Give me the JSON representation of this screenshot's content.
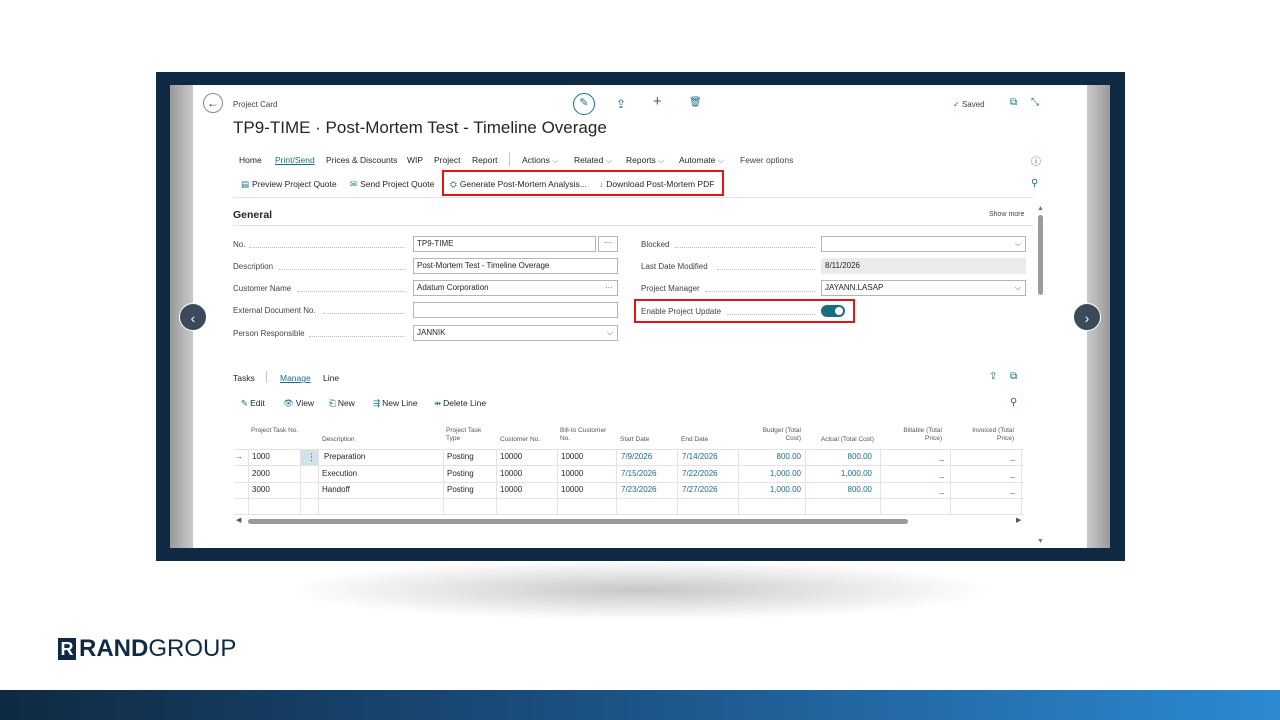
{
  "breadcrumb": "Project Card",
  "title": "TP9-TIME · Post-Mortem Test - Timeline Overage",
  "status": "Saved",
  "icons": {
    "back": "←",
    "edit": "✎",
    "share": "⇪",
    "add": "+",
    "delete": "🗑",
    "saved_check": "✓",
    "open_new": "⧉",
    "collapse": "⤡",
    "info": "ⓘ",
    "pin": "⚲",
    "prev": "‹",
    "next": "›"
  },
  "menu": [
    {
      "label": "Home",
      "active": false
    },
    {
      "label": "Print/Send",
      "active": true
    },
    {
      "label": "Prices & Discounts",
      "active": false
    },
    {
      "label": "WIP",
      "active": false
    },
    {
      "label": "Project",
      "active": false
    },
    {
      "label": "Report",
      "active": false
    },
    {
      "label": "Actions",
      "active": false
    },
    {
      "label": "Related",
      "active": false
    },
    {
      "label": "Reports",
      "active": false
    },
    {
      "label": "Automate",
      "active": false
    },
    {
      "label": "Fewer options",
      "active": false
    }
  ],
  "actions": {
    "preview": "Preview Project Quote",
    "send": "Send Project Quote",
    "generate": "Generate Post-Mortem Analysis...",
    "download": "Download Post-Mortem PDF"
  },
  "general": {
    "title": "General",
    "show_more": "Show more",
    "no_label": "No.",
    "no_value": "TP9-TIME",
    "description_label": "Description",
    "description_value": "Post-Mortem Test - Timeline Overage",
    "customer_label": "Customer Name",
    "customer_value": "Adatum Corporation",
    "ext_doc_label": "External Document No.",
    "ext_doc_value": "",
    "person_label": "Person Responsible",
    "person_value": "JANNIK",
    "blocked_label": "Blocked",
    "blocked_value": "",
    "last_modified_label": "Last Date Modified",
    "last_modified_value": "8/11/2026",
    "manager_label": "Project Manager",
    "manager_value": "JAYANN.LASAP",
    "enable_update_label": "Enable Project Update",
    "enable_update_on": true
  },
  "tasks": {
    "title": "Tasks",
    "tabs": [
      "Manage",
      "Line"
    ],
    "actions": [
      "Edit",
      "View",
      "New",
      "New Line",
      "Delete Line"
    ],
    "headers": [
      "Project Task No.",
      "Description",
      "Project Task Type",
      "Customer No.",
      "Bill-to Customer No.",
      "Start Date",
      "End Date",
      "Budget (Total Cost)",
      "Actual (Total Cost)",
      "Billable (Total Price)",
      "Invoiced (Total Price)"
    ],
    "rows": [
      {
        "no": "1000",
        "description": "Preparation",
        "type": "Posting",
        "customer": "10000",
        "bill_to": "10000",
        "start": "7/9/2026",
        "end": "7/14/2026",
        "budget": "800.00",
        "actual": "800.00",
        "billable": "_",
        "invoiced": "_"
      },
      {
        "no": "2000",
        "description": "Execution",
        "type": "Posting",
        "customer": "10000",
        "bill_to": "10000",
        "start": "7/15/2026",
        "end": "7/22/2026",
        "budget": "1,000.00",
        "actual": "1,000.00",
        "billable": "_",
        "invoiced": "_"
      },
      {
        "no": "3000",
        "description": "Handoff",
        "type": "Posting",
        "customer": "10000",
        "bill_to": "10000",
        "start": "7/23/2026",
        "end": "7/27/2026",
        "budget": "1,000.00",
        "actual": "800.00",
        "billable": "_",
        "invoiced": "_"
      }
    ]
  },
  "brand": {
    "mark": "R",
    "name_bold": "RAND",
    "name_light": "GROUP"
  },
  "colors": {
    "accent": "#1b6e82",
    "highlight": "#e01515",
    "frame": "#0f2a42"
  }
}
